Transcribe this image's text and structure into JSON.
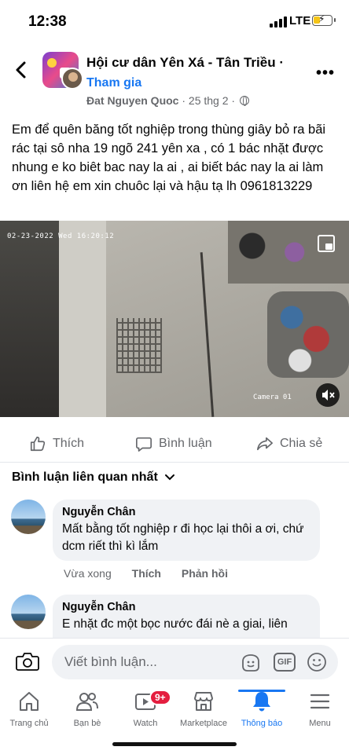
{
  "status_bar": {
    "time": "12:38",
    "network": "LTE",
    "battery_level": 0.4
  },
  "header": {
    "group_name": "Hội cư dân Yên Xá - Tân Triều ·",
    "join_label": "Tham gia",
    "author": "Đat Nguyen Quoc",
    "date": "· 25 thg 2 ·"
  },
  "post": {
    "text": "Em để quên băng tốt nghiệp trong thùng giây bỏ ra bãi rác tại sô nha 19 ngõ 241 yên xa , có 1 bác nhặt được nhung e ko biêt bac nay la ai , ai biết bác nay la ai  làm ơn liên hệ em xin chuôc lại và hậu tạ lh 0961813229",
    "video": {
      "timestamp": "02-23-2022 Wed 16:20:12",
      "camera": "Camera 01"
    }
  },
  "actions": {
    "like": "Thích",
    "comment": "Bình luận",
    "share": "Chia sẻ"
  },
  "comments_sort": "Bình luận liên quan nhất",
  "comments": [
    {
      "name": "Nguyễn Chân",
      "text": "Mất bằng tốt nghiệp r đi học lại thôi a ơi, chứ dcm riết thì kì lắm",
      "time": "Vừa xong",
      "like": "Thích",
      "reply": "Phản hồi"
    },
    {
      "name": "Nguyễn Chân",
      "text": "E nhặt đc một bọc nước đái nè a giai, liên"
    }
  ],
  "composer": {
    "placeholder": "Viết bình luận...",
    "gif": "GIF"
  },
  "tabbar": {
    "home": "Trang chủ",
    "friends": "Bạn bè",
    "watch": "Watch",
    "watch_badge": "9+",
    "marketplace": "Marketplace",
    "notifications": "Thông báo",
    "menu": "Menu"
  },
  "colors": {
    "accent": "#1877f2",
    "badge": "#e41e3f",
    "secondary_text": "#65676b",
    "bubble": "#f0f2f5"
  }
}
